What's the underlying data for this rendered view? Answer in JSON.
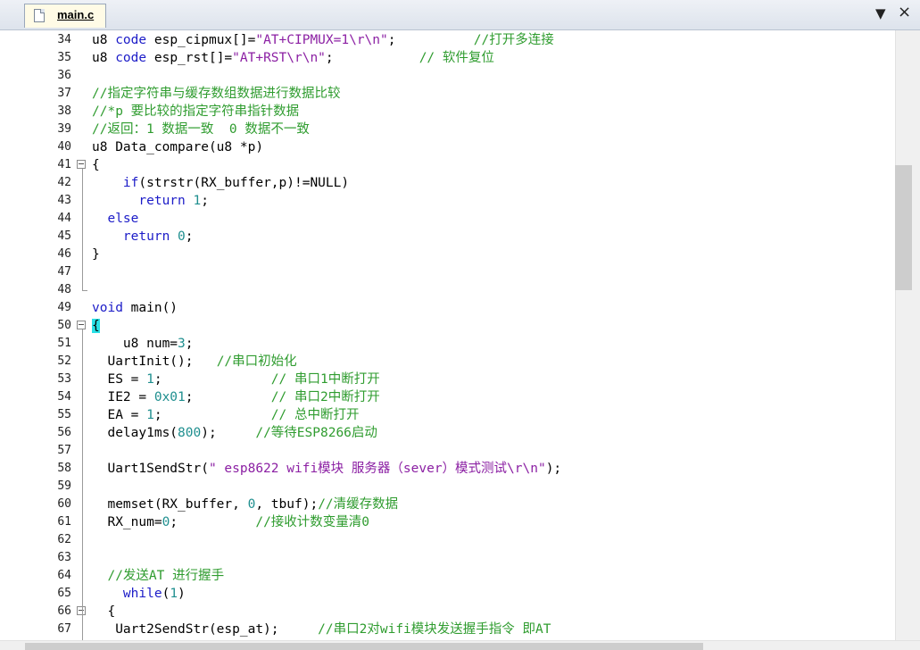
{
  "tab": {
    "filename": "main.c",
    "dropdown_icon": "▼",
    "close_icon": "×"
  },
  "lines": [
    {
      "n": "34",
      "parts": [
        [
          "pl",
          "u8 "
        ],
        [
          "kw",
          "code"
        ],
        [
          "pl",
          " esp_cipmux[]="
        ],
        [
          "st",
          "\"AT+CIPMUX=1\\r\\n\""
        ],
        [
          "pl",
          ";          "
        ],
        [
          "cm",
          "//打开多连接"
        ]
      ]
    },
    {
      "n": "35",
      "parts": [
        [
          "pl",
          "u8 "
        ],
        [
          "kw",
          "code"
        ],
        [
          "pl",
          " esp_rst[]="
        ],
        [
          "st",
          "\"AT+RST\\r\\n\""
        ],
        [
          "pl",
          ";           "
        ],
        [
          "cm",
          "// 软件复位"
        ]
      ]
    },
    {
      "n": "36",
      "parts": []
    },
    {
      "n": "37",
      "parts": [
        [
          "cm",
          "//指定字符串与缓存数组数据进行数据比较"
        ]
      ]
    },
    {
      "n": "38",
      "parts": [
        [
          "cm",
          "//*p 要比较的指定字符串指针数据"
        ]
      ]
    },
    {
      "n": "39",
      "parts": [
        [
          "cm",
          "//返回：1 数据一致  0 数据不一致"
        ]
      ]
    },
    {
      "n": "40",
      "parts": [
        [
          "pl",
          "u8 Data_compare(u8 *p)"
        ]
      ]
    },
    {
      "n": "41",
      "parts": [
        [
          "pl",
          "{"
        ]
      ],
      "fold": true
    },
    {
      "n": "42",
      "parts": [
        [
          "pl",
          "    "
        ],
        [
          "kw",
          "if"
        ],
        [
          "pl",
          "(strstr(RX_buffer,p)!=NULL)"
        ]
      ]
    },
    {
      "n": "43",
      "parts": [
        [
          "pl",
          "      "
        ],
        [
          "kw",
          "return"
        ],
        [
          "pl",
          " "
        ],
        [
          "nu",
          "1"
        ],
        [
          "pl",
          ";"
        ]
      ]
    },
    {
      "n": "44",
      "parts": [
        [
          "pl",
          "  "
        ],
        [
          "kw",
          "else"
        ]
      ]
    },
    {
      "n": "45",
      "parts": [
        [
          "pl",
          "    "
        ],
        [
          "kw",
          "return"
        ],
        [
          "pl",
          " "
        ],
        [
          "nu",
          "0"
        ],
        [
          "pl",
          ";"
        ]
      ]
    },
    {
      "n": "46",
      "parts": [
        [
          "pl",
          "}"
        ]
      ]
    },
    {
      "n": "47",
      "parts": []
    },
    {
      "n": "48",
      "parts": []
    },
    {
      "n": "49",
      "parts": [
        [
          "kw",
          "void"
        ],
        [
          "pl",
          " main()"
        ]
      ]
    },
    {
      "n": "50",
      "parts": [
        [
          "hl",
          "{"
        ]
      ],
      "fold": true
    },
    {
      "n": "51",
      "parts": [
        [
          "pl",
          "    u8 num="
        ],
        [
          "nu",
          "3"
        ],
        [
          "pl",
          ";"
        ]
      ]
    },
    {
      "n": "52",
      "parts": [
        [
          "pl",
          "  UartInit();   "
        ],
        [
          "cm",
          "//串口初始化"
        ]
      ]
    },
    {
      "n": "53",
      "parts": [
        [
          "pl",
          "  ES = "
        ],
        [
          "nu",
          "1"
        ],
        [
          "pl",
          ";              "
        ],
        [
          "cm",
          "// 串口1中断打开"
        ]
      ]
    },
    {
      "n": "54",
      "parts": [
        [
          "pl",
          "  IE2 = "
        ],
        [
          "nu",
          "0x01"
        ],
        [
          "pl",
          ";          "
        ],
        [
          "cm",
          "// 串口2中断打开"
        ]
      ]
    },
    {
      "n": "55",
      "parts": [
        [
          "pl",
          "  EA = "
        ],
        [
          "nu",
          "1"
        ],
        [
          "pl",
          ";              "
        ],
        [
          "cm",
          "// 总中断打开"
        ]
      ]
    },
    {
      "n": "56",
      "parts": [
        [
          "pl",
          "  delay1ms("
        ],
        [
          "nu",
          "800"
        ],
        [
          "pl",
          ");     "
        ],
        [
          "cm",
          "//等待ESP8266启动"
        ]
      ]
    },
    {
      "n": "57",
      "parts": []
    },
    {
      "n": "58",
      "parts": [
        [
          "pl",
          "  Uart1SendStr("
        ],
        [
          "st",
          "\" esp8622 wifi模块 服务器（sever）模式测试\\r\\n\""
        ],
        [
          "pl",
          ");"
        ]
      ]
    },
    {
      "n": "59",
      "parts": []
    },
    {
      "n": "60",
      "parts": [
        [
          "pl",
          "  memset(RX_buffer, "
        ],
        [
          "nu",
          "0"
        ],
        [
          "pl",
          ", tbuf);"
        ],
        [
          "cm",
          "//清缓存数据"
        ]
      ]
    },
    {
      "n": "61",
      "parts": [
        [
          "pl",
          "  RX_num="
        ],
        [
          "nu",
          "0"
        ],
        [
          "pl",
          ";          "
        ],
        [
          "cm",
          "//接收计数变量清0"
        ]
      ]
    },
    {
      "n": "62",
      "parts": []
    },
    {
      "n": "63",
      "parts": []
    },
    {
      "n": "64",
      "parts": [
        [
          "pl",
          "  "
        ],
        [
          "cm",
          "//发送AT 进行握手"
        ]
      ]
    },
    {
      "n": "65",
      "parts": [
        [
          "pl",
          "    "
        ],
        [
          "kw",
          "while"
        ],
        [
          "pl",
          "("
        ],
        [
          "nu",
          "1"
        ],
        [
          "pl",
          ")"
        ]
      ]
    },
    {
      "n": "66",
      "parts": [
        [
          "pl",
          "  {"
        ]
      ],
      "fold": true
    },
    {
      "n": "67",
      "parts": [
        [
          "pl",
          "   Uart2SendStr(esp_at);     "
        ],
        [
          "cm",
          "//串口2对wifi模块发送握手指令 即AT"
        ]
      ]
    }
  ]
}
